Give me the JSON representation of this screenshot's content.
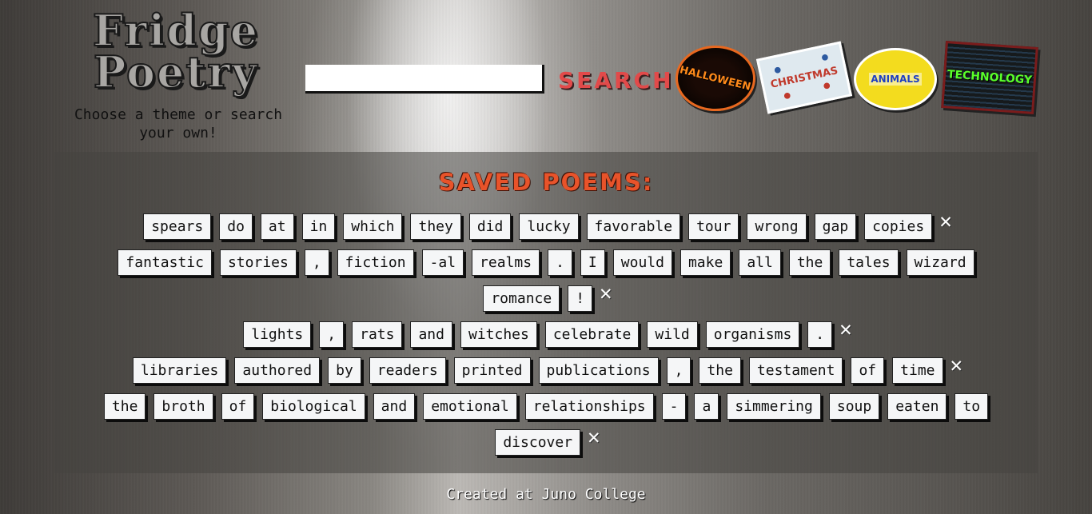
{
  "header": {
    "title_line1": "Fridge",
    "title_line2": "Poetry",
    "tagline": "Choose a theme or search your own!"
  },
  "search": {
    "value": "",
    "placeholder": "",
    "button_label": "SEARCH"
  },
  "themes": [
    {
      "label": "HALLOWEEN",
      "icon": "pumpkin-icon",
      "color": "#ff8a1a"
    },
    {
      "label": "CHRISTMAS",
      "icon": "reindeer-icon",
      "color": "#c0392b"
    },
    {
      "label": "ANIMALS",
      "icon": "animal-icon",
      "color": "#1f3fc2"
    },
    {
      "label": "TECHNOLOGY",
      "icon": "code-icon",
      "color": "#5aff2a"
    }
  ],
  "saved": {
    "title": "SAVED POEMS:",
    "delete_symbol": "✕",
    "lines": [
      {
        "words": [
          "spears",
          "do",
          "at",
          "in",
          "which",
          "they",
          "did",
          "lucky",
          "favorable",
          "tour",
          "wrong",
          "gap",
          "copies"
        ],
        "delete": true
      },
      {
        "words": [
          "fantastic",
          "stories",
          ",",
          "fiction",
          "-al",
          "realms",
          ".",
          "I",
          "would",
          "make",
          "all",
          "the",
          "tales",
          "wizard"
        ],
        "delete": false
      },
      {
        "words": [
          "romance",
          "!"
        ],
        "delete": true
      },
      {
        "words": [
          "lights",
          ",",
          "rats",
          "and",
          "witches",
          "celebrate",
          "wild",
          "organisms",
          "."
        ],
        "delete": true
      },
      {
        "words": [
          "libraries",
          "authored",
          "by",
          "readers",
          "printed",
          "publications",
          ",",
          "the",
          "testament",
          "of",
          "time"
        ],
        "delete": true
      },
      {
        "words": [
          "the",
          "broth",
          "of",
          "biological",
          "and",
          "emotional",
          "relationships",
          "-",
          "a",
          "simmering",
          "soup",
          "eaten",
          "to"
        ],
        "delete": false
      },
      {
        "words": [
          "discover"
        ],
        "delete": true
      }
    ]
  },
  "footer": {
    "text": "Created at Juno College"
  },
  "colors": {
    "accent": "#e24a4a",
    "title": "#e8532a"
  }
}
